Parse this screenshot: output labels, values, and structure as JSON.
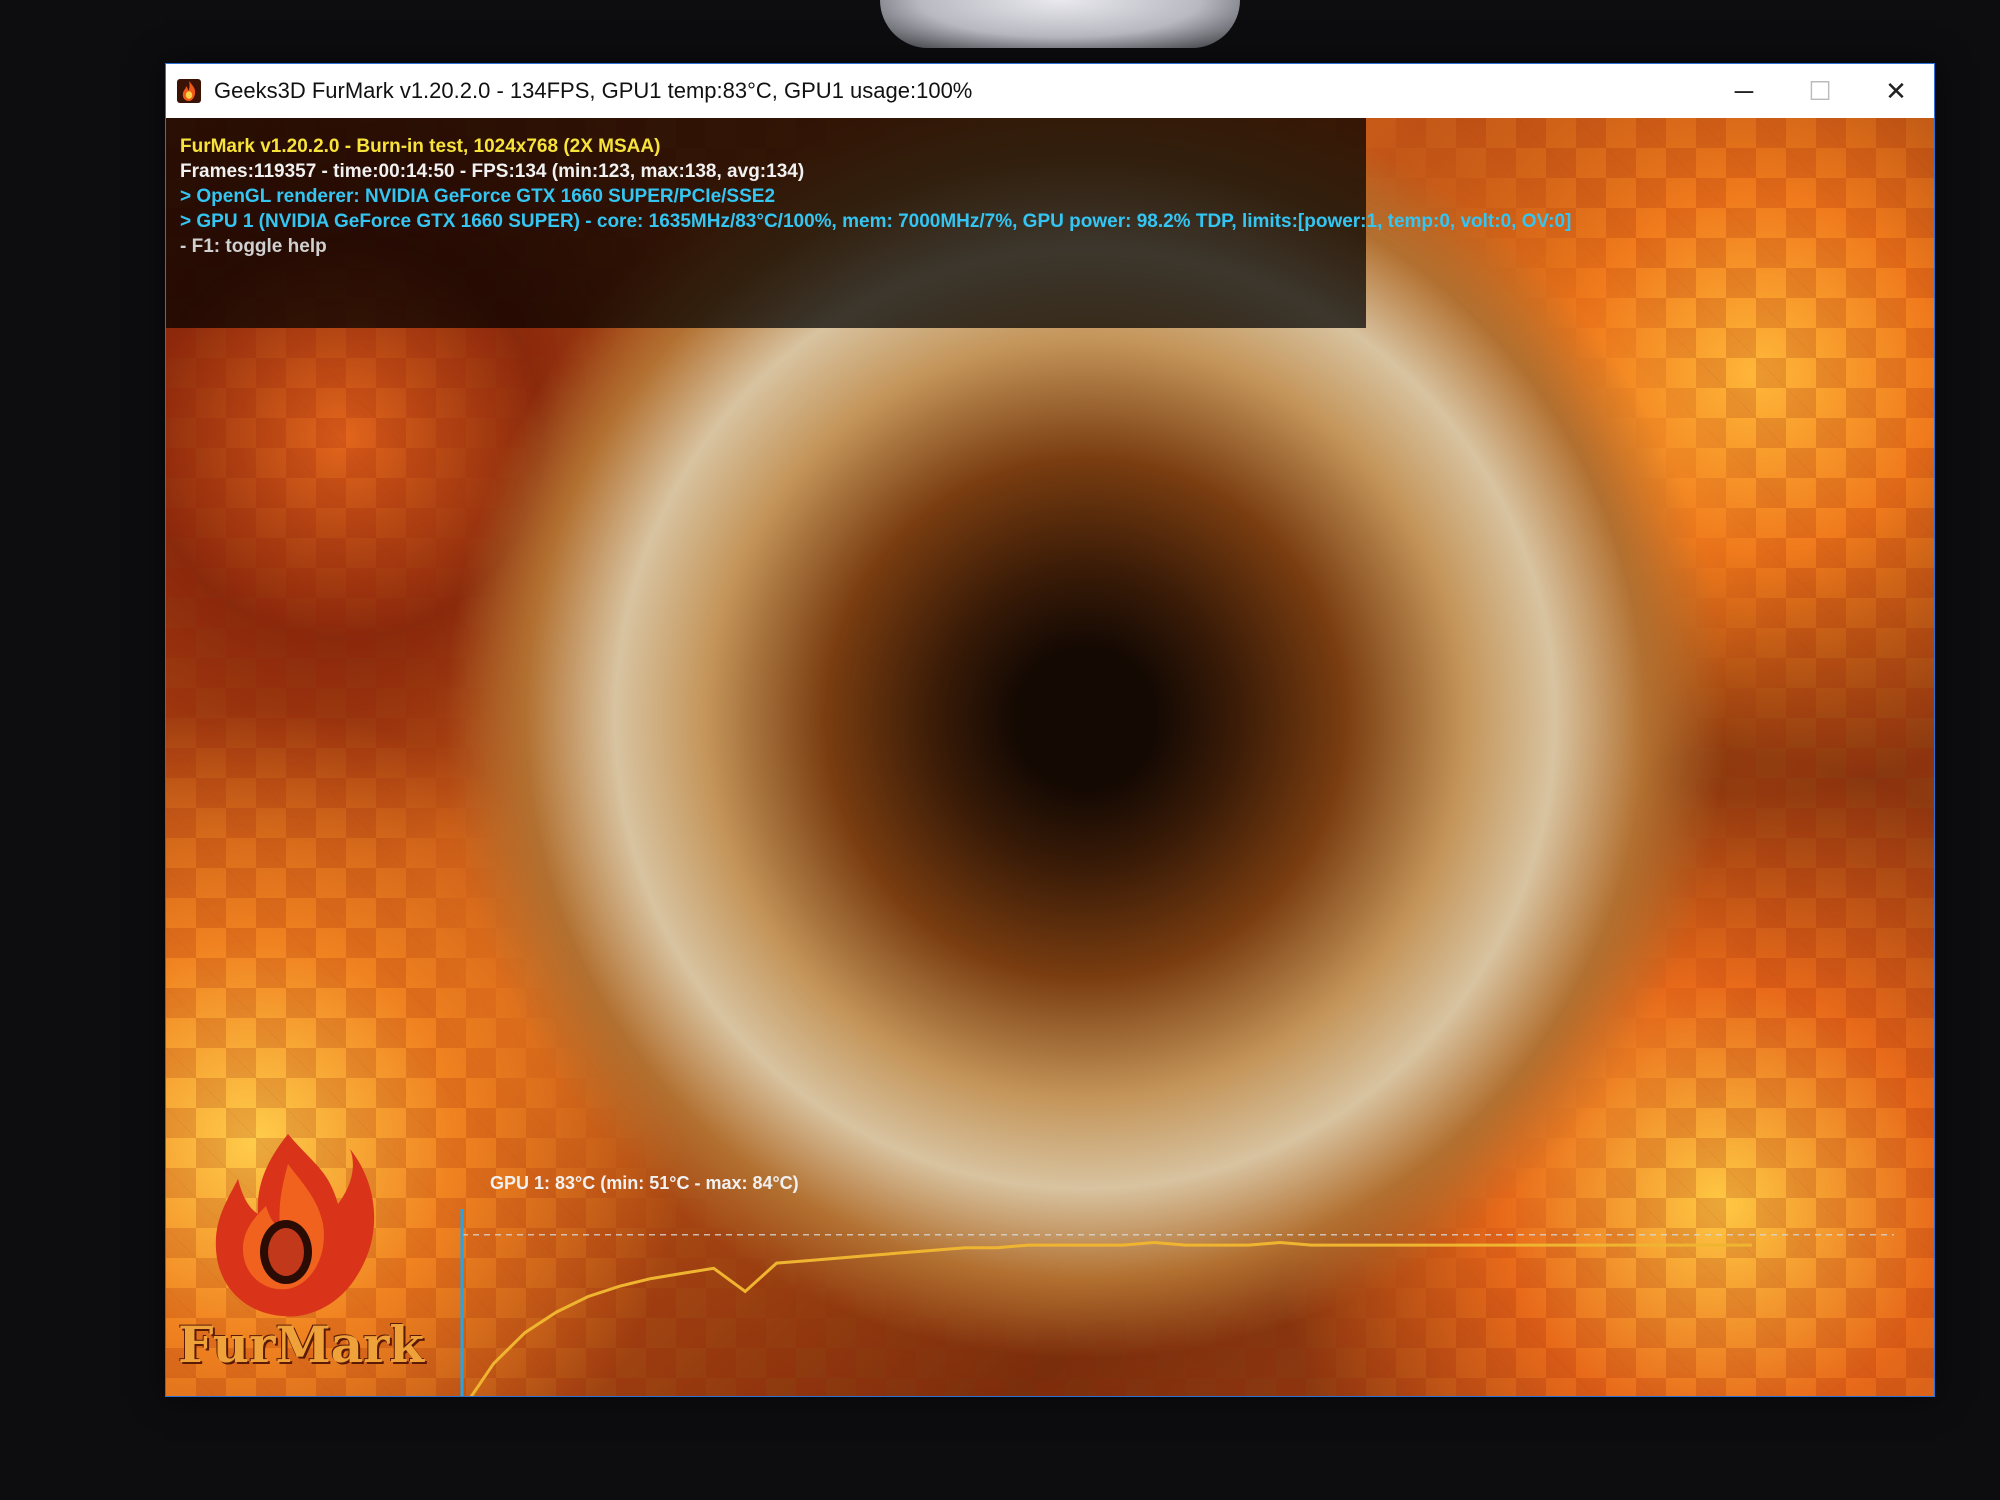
{
  "window": {
    "title": "Geeks3D FurMark v1.20.2.0 - 134FPS, GPU1 temp:83°C, GPU1 usage:100%",
    "app_icon": "furmark-flame-icon",
    "controls": {
      "minimize": "─",
      "maximize": "☐",
      "close": "✕"
    }
  },
  "osd": {
    "line1": "FurMark v1.20.2.0 - Burn-in test, 1024x768 (2X MSAA)",
    "line2": "Frames:119357 - time:00:14:50 - FPS:134 (min:123, max:138, avg:134)",
    "line3": "> OpenGL renderer: NVIDIA GeForce GTX 1660 SUPER/PCIe/SSE2",
    "line4": "> GPU 1 (NVIDIA GeForce GTX 1660 SUPER) - core: 1635MHz/83°C/100%, mem: 7000MHz/7%, GPU power: 98.2% TDP, limits:[power:1, temp:0, volt:0, OV:0]",
    "line5": "- F1: toggle help"
  },
  "logo": {
    "text": "FurMark"
  },
  "colors": {
    "yellow": "#f7e33a",
    "cyan": "#34c5f2",
    "graph_line": "#f0b530",
    "graph_axis": "#2aa3e0"
  },
  "chart_data": {
    "type": "line",
    "title": "GPU 1: 83°C (min: 51°C - max: 84°C)",
    "xlabel": "",
    "ylabel": "",
    "ylim": [
      45,
      90
    ],
    "reference_lines": [
      50,
      85
    ],
    "series": [
      {
        "values": [
          51,
          60,
          66,
          70,
          73,
          75,
          76.5,
          77.5,
          78.5,
          74,
          79.5,
          80,
          80.5,
          81,
          81.5,
          82,
          82.5,
          82.5,
          83,
          83,
          83,
          83,
          83.5,
          83,
          83,
          83,
          83.5,
          83,
          83,
          83,
          83,
          83,
          83,
          83,
          83,
          83,
          83,
          83,
          83,
          83,
          83,
          83
        ]
      }
    ]
  }
}
